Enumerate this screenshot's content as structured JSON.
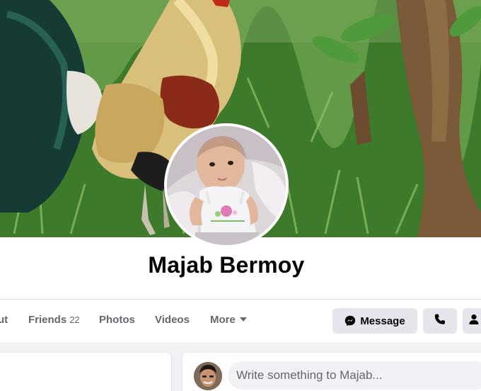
{
  "profile": {
    "name": "Majab Bermoy"
  },
  "tabs": [
    {
      "label": "ut"
    },
    {
      "label": "Friends",
      "count": "22"
    },
    {
      "label": "Photos"
    },
    {
      "label": "Videos"
    },
    {
      "label": "More"
    }
  ],
  "actions": {
    "message_label": "Message"
  },
  "composer": {
    "placeholder": "Write something to Majab..."
  },
  "icons": {
    "message": "messenger-icon",
    "call": "phone-icon",
    "friend": "person-icon",
    "more_caret": "caret-down-icon"
  },
  "colors": {
    "tab_text": "#65676b",
    "button_bg": "#e4e6eb",
    "page_bg": "#f0f2f5"
  }
}
